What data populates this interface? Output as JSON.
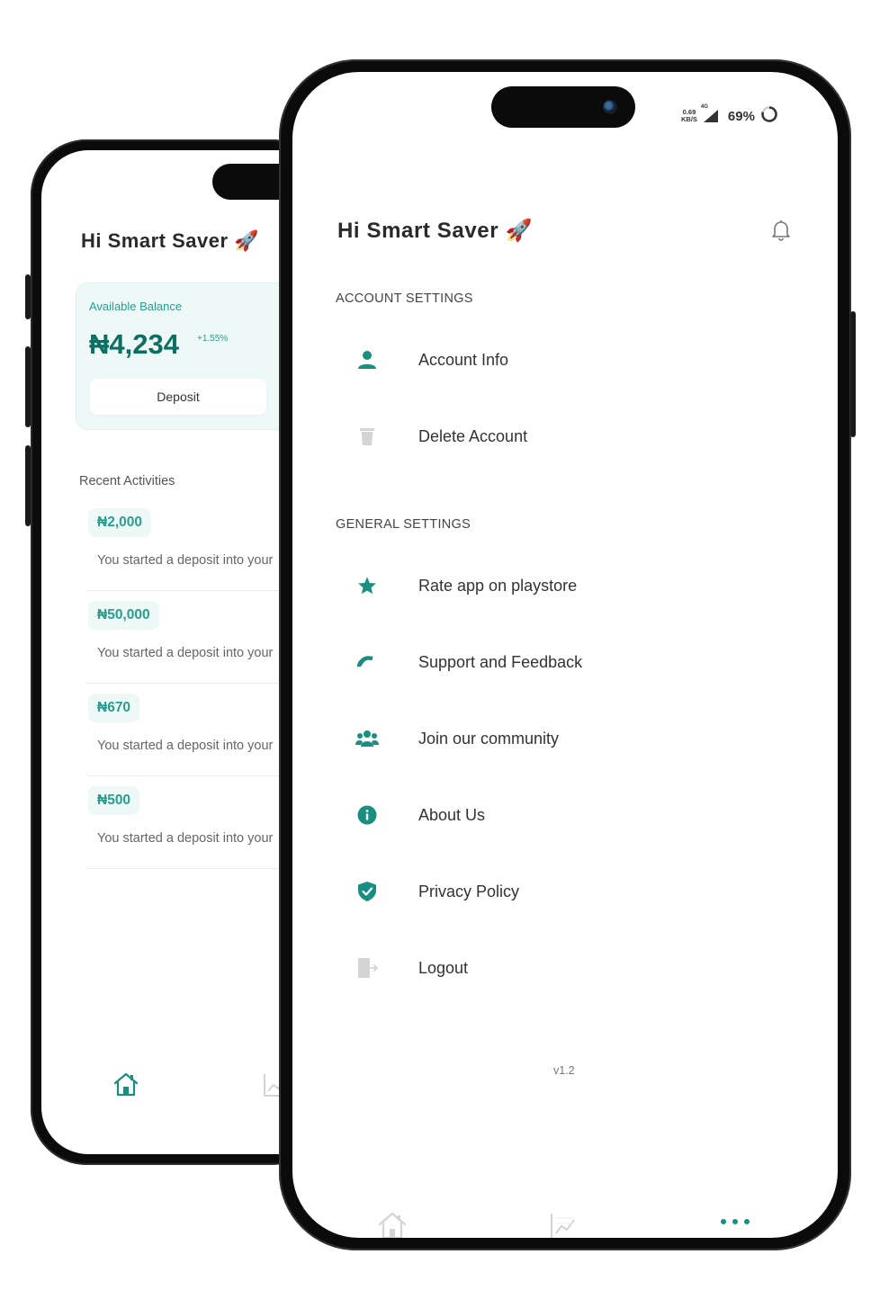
{
  "back_phone": {
    "greeting": "Hi Smart Saver",
    "greeting_emoji": "🚀",
    "balance": {
      "label": "Available Balance",
      "amount": "₦4,234",
      "change": "+1.55%",
      "deposit_label": "Deposit"
    },
    "recent_title": "Recent Activities",
    "activities": [
      {
        "amount": "₦2,000",
        "desc": "You started a deposit into your"
      },
      {
        "amount": "₦50,000",
        "desc": "You started a deposit into your"
      },
      {
        "amount": "₦670",
        "desc": "You started a deposit into your"
      },
      {
        "amount": "₦500",
        "desc": "You started a deposit into your"
      }
    ]
  },
  "front_phone": {
    "status": {
      "net_speed_value": "0.69",
      "net_speed_unit": "KB/S",
      "network": "4G",
      "battery": "69%"
    },
    "greeting": "Hi Smart Saver",
    "greeting_emoji": "🚀",
    "account_section": {
      "title": "ACCOUNT SETTINGS",
      "items": [
        {
          "label": "Account Info",
          "icon": "person-icon"
        },
        {
          "label": "Delete Account",
          "icon": "trash-icon"
        }
      ]
    },
    "general_section": {
      "title": "GENERAL SETTINGS",
      "items": [
        {
          "label": "Rate app on playstore",
          "icon": "star-icon"
        },
        {
          "label": "Support and Feedback",
          "icon": "phone-icon"
        },
        {
          "label": "Join our community",
          "icon": "group-icon"
        },
        {
          "label": "About Us",
          "icon": "info-icon"
        },
        {
          "label": "Privacy Policy",
          "icon": "shield-check-icon"
        },
        {
          "label": "Logout",
          "icon": "logout-icon"
        }
      ]
    },
    "version": "v1.2"
  },
  "colors": {
    "accent": "#188f80",
    "accent_light": "#edf8f7",
    "muted_icon": "#d4d4d4"
  }
}
